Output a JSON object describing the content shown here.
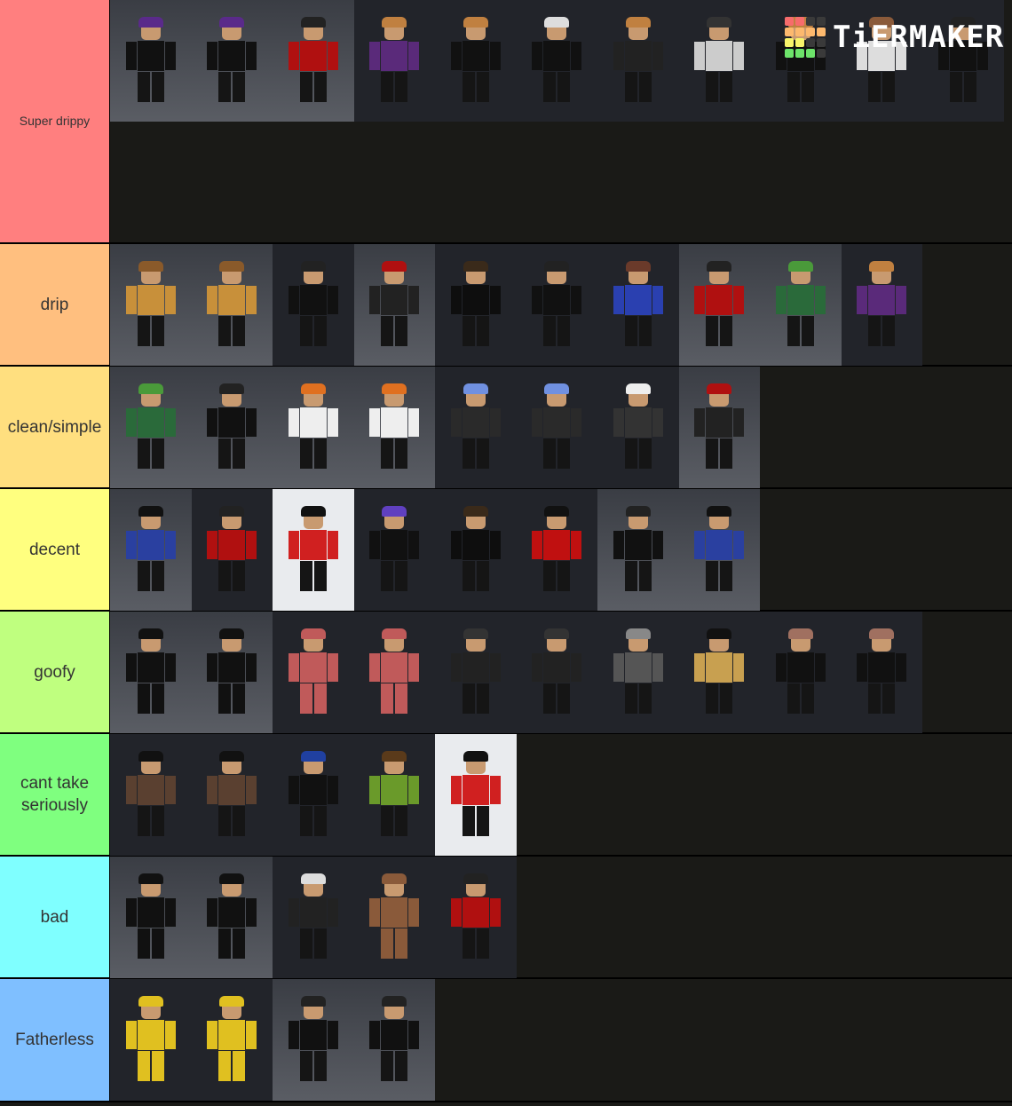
{
  "logo": {
    "text": "TiERMAKER",
    "grid": [
      "#f76c6c",
      "#f76c6c",
      "#3a3a3a",
      "#3a3a3a",
      "#fdb96e",
      "#fdb96e",
      "#fdb96e",
      "#fdb96e",
      "#f8f46a",
      "#f8f46a",
      "#3a3a3a",
      "#3a3a3a",
      "#6de46a",
      "#6de46a",
      "#6de46a",
      "#3a3a3a"
    ]
  },
  "tiers": [
    {
      "label": "Super drippy",
      "color": "#ff7f7f",
      "small": true,
      "tiles": [
        [
          "gray",
          "#111",
          "#5a2a8a"
        ],
        [
          "gray",
          "#111",
          "#5a2a8a"
        ],
        [
          "gray",
          "#b01010",
          "#222"
        ],
        [
          "dark",
          "#5a2a7a",
          "#c08040"
        ],
        [
          "dark",
          "#111",
          "#c08040"
        ],
        [
          "dark",
          "#111",
          "#ddd"
        ],
        [
          "dark",
          "#222",
          "#c08040"
        ],
        [
          "dark",
          "#ccc",
          "#333"
        ],
        [
          "dark",
          "#111",
          "#c08040"
        ],
        [
          "dark",
          "#ddd",
          "#8a5a3a"
        ],
        [
          "dark",
          "#111",
          "#222"
        ]
      ]
    },
    {
      "label": "drip",
      "color": "#ffbf7f",
      "tiles": [
        [
          "gray",
          "#c8903a",
          "#8a5a2a"
        ],
        [
          "gray",
          "#c8903a",
          "#8a5a2a"
        ],
        [
          "dark",
          "#111",
          "#222"
        ],
        [
          "gray",
          "#222",
          "#b01010"
        ],
        [
          "dark",
          "#0e0e0e",
          "#3a2a1a"
        ],
        [
          "dark",
          "#111",
          "#222"
        ],
        [
          "dark",
          "#2a40b0",
          "#6a3a2a"
        ],
        [
          "gray",
          "#b01010",
          "#222"
        ],
        [
          "gray",
          "#2a6a3a",
          "#4a9a3a"
        ],
        [
          "dark",
          "#5a2a7a",
          "#c08040"
        ]
      ]
    },
    {
      "label": "clean/simple",
      "color": "#ffdf7f",
      "tiles": [
        [
          "gray",
          "#2a6a3a",
          "#4a9a3a"
        ],
        [
          "gray",
          "#111",
          "#222"
        ],
        [
          "gray",
          "#eee",
          "#e07020"
        ],
        [
          "gray",
          "#eee",
          "#e07020"
        ],
        [
          "dark",
          "#2a2a2a",
          "#7090e0"
        ],
        [
          "dark",
          "#2a2a2a",
          "#7090e0"
        ],
        [
          "dark",
          "#333",
          "#eee"
        ],
        [
          "gray",
          "#222",
          "#b01010"
        ]
      ]
    },
    {
      "label": "decent",
      "color": "#ffff7f",
      "tiles": [
        [
          "gray",
          "#2a40a0",
          "#111"
        ],
        [
          "dark",
          "#b01010",
          "#222"
        ],
        [
          "white",
          "#d02020",
          "#111"
        ],
        [
          "dark",
          "#111",
          "#6040c0"
        ],
        [
          "dark",
          "#0e0e0e",
          "#3a2a1a"
        ],
        [
          "dark",
          "#c01010",
          "#111"
        ],
        [
          "gray",
          "#111",
          "#222"
        ],
        [
          "gray",
          "#2a40a0",
          "#111"
        ]
      ]
    },
    {
      "label": "goofy",
      "color": "#bfff7f",
      "tiles": [
        [
          "gray",
          "#111",
          "#111"
        ],
        [
          "gray",
          "#111",
          "#111"
        ],
        [
          "dark",
          "#c05a5a",
          "#c05a5a"
        ],
        [
          "dark",
          "#c05a5a",
          "#c05a5a"
        ],
        [
          "dark",
          "#222",
          "#333"
        ],
        [
          "dark",
          "#222",
          "#333"
        ],
        [
          "dark",
          "#555",
          "#888"
        ],
        [
          "dark",
          "#c8a050",
          "#111"
        ],
        [
          "dark",
          "#111",
          "#a07060"
        ],
        [
          "dark",
          "#111",
          "#a07060"
        ]
      ]
    },
    {
      "label": "cant take seriously",
      "color": "#7fff7f",
      "tiles": [
        [
          "dark",
          "#5a4030",
          "#111"
        ],
        [
          "dark",
          "#5a4030",
          "#111"
        ],
        [
          "dark",
          "#111",
          "#2040a0"
        ],
        [
          "dark",
          "#6a9a2a",
          "#5a3a1a"
        ],
        [
          "white",
          "#d02020",
          "#111"
        ]
      ]
    },
    {
      "label": "bad",
      "color": "#7fffff",
      "tiles": [
        [
          "gray",
          "#111",
          "#111"
        ],
        [
          "gray",
          "#111",
          "#111"
        ],
        [
          "dark",
          "#222",
          "#ddd"
        ],
        [
          "dark",
          "#8a5a3a",
          "#8a5a3a"
        ],
        [
          "dark",
          "#b01010",
          "#222"
        ]
      ]
    },
    {
      "label": "Fatherless",
      "color": "#7fbfff",
      "tiles": [
        [
          "dark",
          "#e0c020",
          "#e0c020"
        ],
        [
          "dark",
          "#e0c020",
          "#e0c020"
        ],
        [
          "gray",
          "#111",
          "#222"
        ],
        [
          "gray",
          "#111",
          "#222"
        ]
      ]
    }
  ]
}
